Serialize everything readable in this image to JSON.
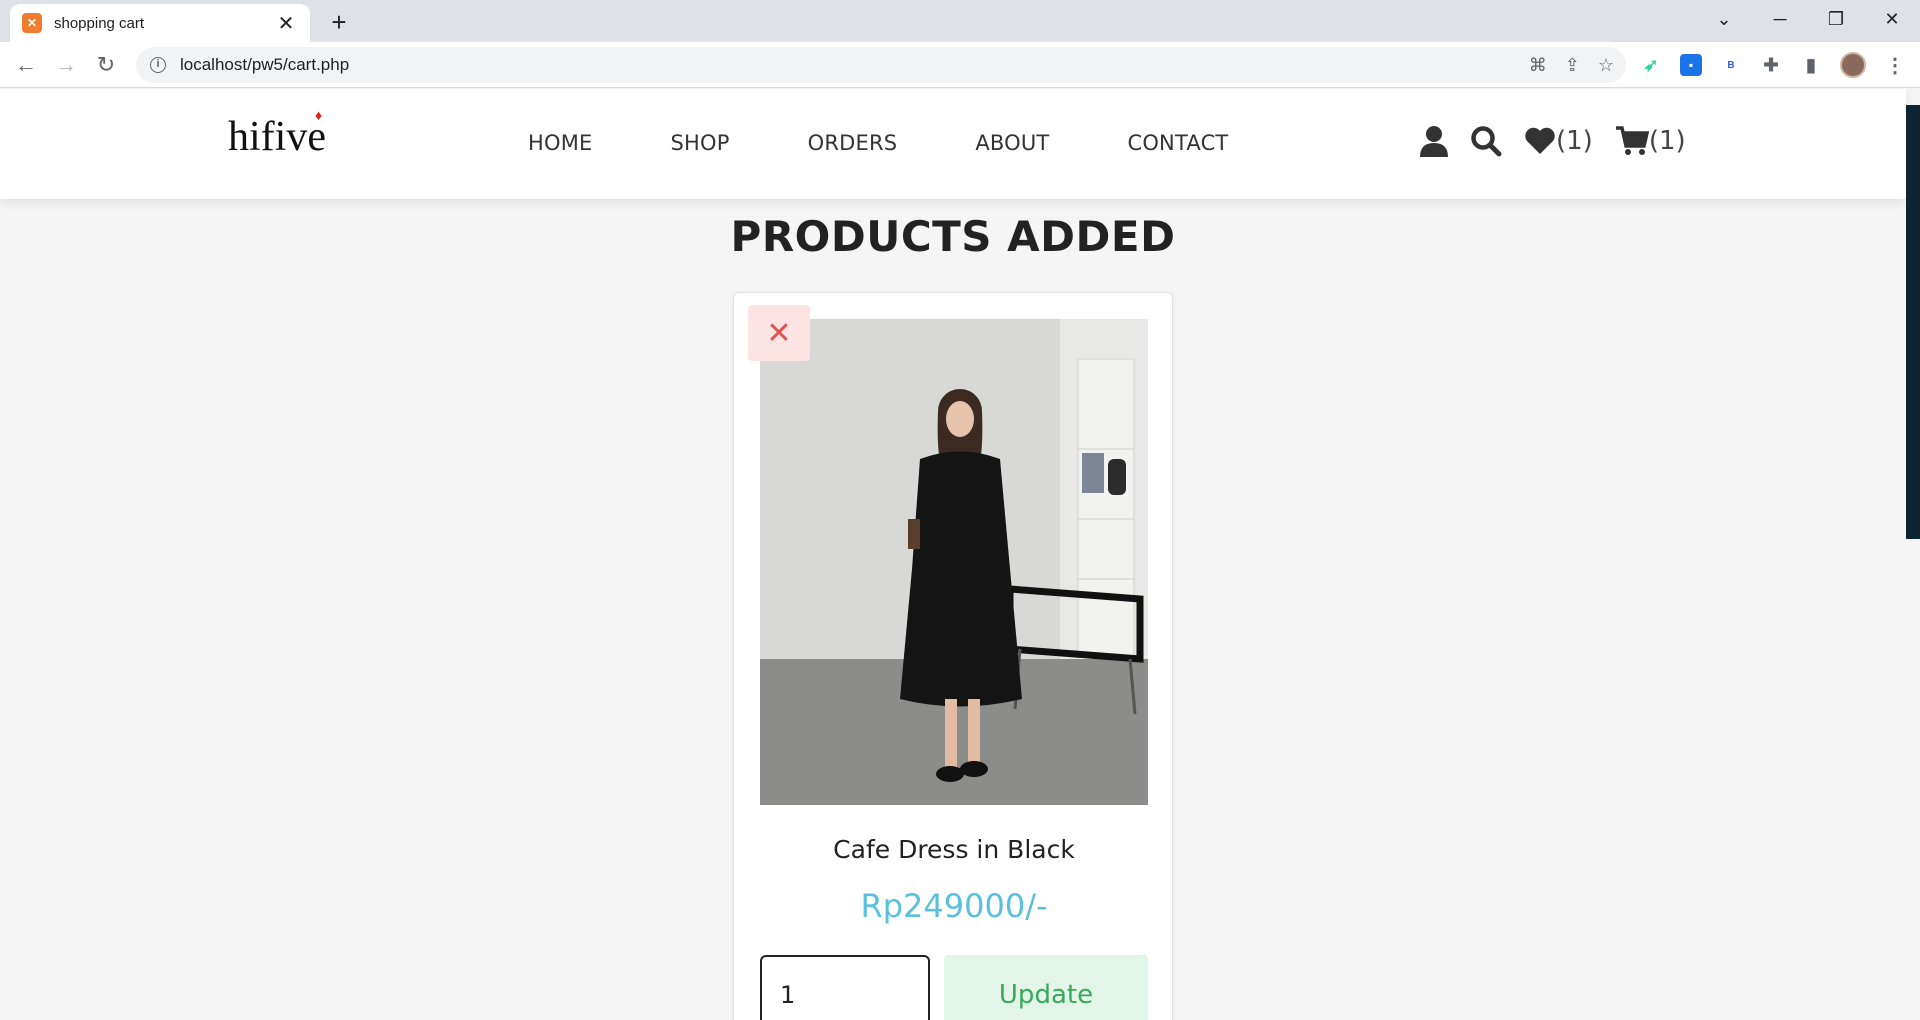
{
  "browser": {
    "tab_title": "shopping cart",
    "url": "localhost/pw5/cart.php"
  },
  "site": {
    "logo": "hifive",
    "nav": [
      "HOME",
      "SHOP",
      "ORDERS",
      "ABOUT",
      "CONTACT"
    ],
    "wishlist_count": "(1)",
    "cart_count": "(1)"
  },
  "page": {
    "heading": "PRODUCTS ADDED"
  },
  "cart_items": [
    {
      "name": "Cafe Dress in Black",
      "price": "Rp249000/-",
      "quantity": "1",
      "update_label": "Update",
      "remove_icon": "close-icon"
    }
  ],
  "colors": {
    "price": "#5bc0de",
    "update_text": "#3aa85a",
    "update_bg": "#e3f4e8",
    "remove": "#e05252"
  }
}
